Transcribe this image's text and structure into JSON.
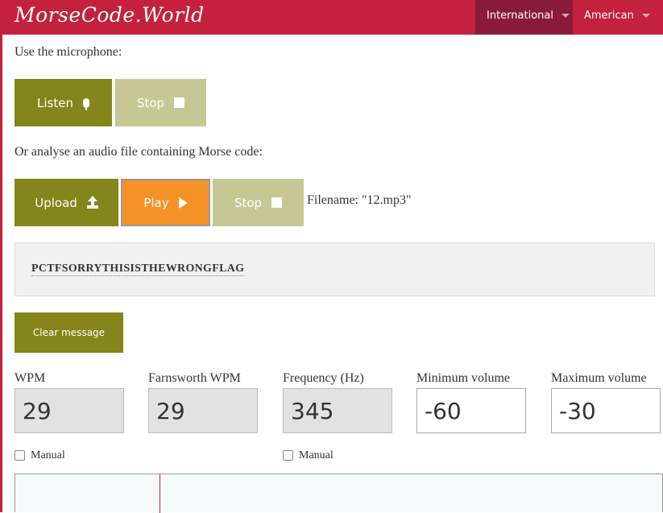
{
  "header": {
    "logo": "MorseCode.World",
    "nav": [
      {
        "label": "International"
      },
      {
        "label": "American"
      }
    ]
  },
  "microphone": {
    "label": "Use the microphone:",
    "listen_label": "Listen",
    "stop_label": "Stop"
  },
  "audio_file": {
    "label": "Or analyse an audio file containing Morse code:",
    "upload_label": "Upload",
    "play_label": "Play",
    "stop_label": "Stop",
    "filename_text": "Filename: \"12.mp3\""
  },
  "message": {
    "text": "PCTFSORRYTHISISTHEWRONGFLAG",
    "clear_label": "Clear message"
  },
  "settings": {
    "wpm": {
      "label": "WPM",
      "value": "29"
    },
    "farnsworth": {
      "label": "Farnsworth WPM",
      "value": "29"
    },
    "frequency": {
      "label": "Frequency (Hz)",
      "value": "345"
    },
    "min_volume": {
      "label": "Minimum volume",
      "value": "-60"
    },
    "max_volume": {
      "label": "Maximum volume",
      "value": "-30"
    },
    "manual_speed_label": "Manual",
    "manual_freq_label": "Manual"
  },
  "colors": {
    "brand": "#c4213f",
    "button_olive": "#84851b",
    "button_disabled": "#c6c795",
    "button_active": "#f59225"
  }
}
